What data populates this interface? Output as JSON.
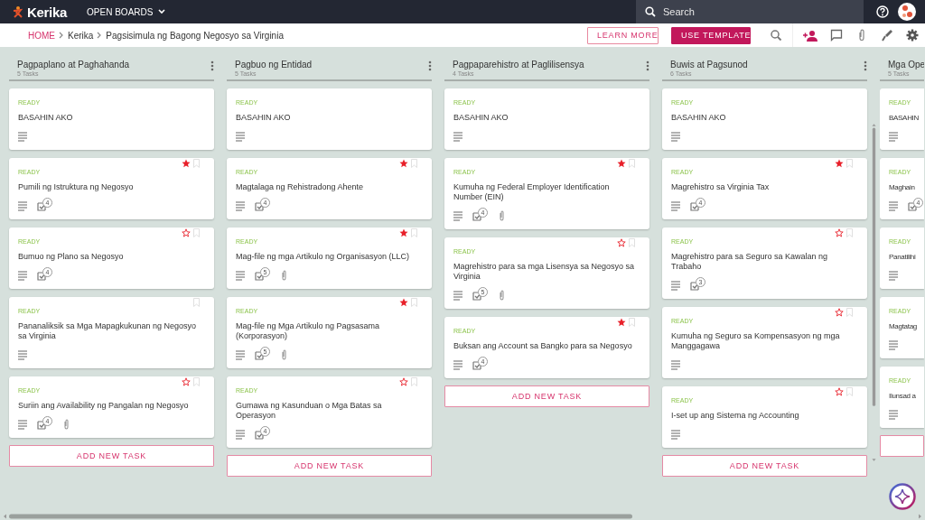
{
  "topbar": {
    "logo": "Kerika",
    "boards_menu": "OPEN BOARDS",
    "search": {
      "placeholder": "Search"
    }
  },
  "breadcrumb": {
    "items": [
      "HOME",
      "Kerika",
      "Pagsisimula ng Bagong Negosyo sa Virginia"
    ],
    "buttons": [
      {
        "kind": "outline",
        "label": "LEARN MORE"
      },
      {
        "kind": "filled",
        "label": "USE TEMPLATE"
      }
    ]
  },
  "columns": [
    {
      "title": "Pagpaplano at Paghahanda",
      "count": "5 Tasks",
      "scrollbar": false,
      "cut": false,
      "add_button": "ADD NEW TASK",
      "cards": [
        {
          "status": "READY",
          "title": "BASAHIN AKO",
          "bookmark": false,
          "attachment": false
        },
        {
          "status": "READY",
          "title": "Pumili ng Istruktura ng Negosyo",
          "starred": true,
          "bookmark": true,
          "checklist": "4",
          "attachment": false
        },
        {
          "status": "READY",
          "title": "Bumuo ng Plano sa Negosyo",
          "starred": false,
          "bookmark": true,
          "checklist": "4",
          "attachment": false
        },
        {
          "status": "READY",
          "title": "Pananaliksik sa Mga Mapagkukunan ng Negosyo sa Virginia",
          "bookmark": true,
          "attachment": false
        },
        {
          "status": "READY",
          "title": "Suriin ang Availability ng Pangalan ng Negosyo",
          "starred": false,
          "bookmark": true,
          "checklist": "4",
          "attachment": true
        }
      ]
    },
    {
      "title": "Pagbuo ng Entidad",
      "count": "5 Tasks",
      "scrollbar": false,
      "cut": false,
      "add_button": "ADD NEW TASK",
      "cards": [
        {
          "status": "READY",
          "title": "BASAHIN AKO",
          "bookmark": false,
          "attachment": false
        },
        {
          "status": "READY",
          "title": "Magtalaga ng Rehistradong Ahente",
          "starred": true,
          "bookmark": true,
          "checklist": "4",
          "attachment": false
        },
        {
          "status": "READY",
          "title": "Mag-file ng mga Artikulo ng Organisasyon (LLC)",
          "starred": true,
          "bookmark": true,
          "checklist": "5",
          "attachment": true
        },
        {
          "status": "READY",
          "title": "Mag-file ng Mga Artikulo ng Pagsasama (Korporasyon)",
          "starred": true,
          "bookmark": true,
          "checklist": "5",
          "attachment": true
        },
        {
          "status": "READY",
          "title": "Gumawa ng Kasunduan o Mga Batas sa Operasyon",
          "starred": false,
          "bookmark": true,
          "checklist": "4",
          "attachment": false
        }
      ]
    },
    {
      "title": "Pagpaparehistro at Paglilisensya",
      "count": "4 Tasks",
      "scrollbar": false,
      "cut": false,
      "add_button": "ADD NEW TASK",
      "cards": [
        {
          "status": "READY",
          "title": "BASAHIN AKO",
          "bookmark": false,
          "attachment": false
        },
        {
          "status": "READY",
          "title": "Kumuha ng Federal Employer Identification Number (EIN)",
          "starred": true,
          "bookmark": true,
          "checklist": "4",
          "attachment": true
        },
        {
          "status": "READY",
          "title": "Magrehistro para sa mga Lisensya sa Negosyo sa Virginia",
          "starred": false,
          "bookmark": true,
          "checklist": "5",
          "attachment": true
        },
        {
          "status": "READY",
          "title": "Buksan ang Account sa Bangko para sa Negosyo",
          "starred": true,
          "bookmark": true,
          "checklist": "4",
          "attachment": false
        }
      ]
    },
    {
      "title": "Buwis at Pagsunod",
      "count": "6 Tasks",
      "scrollbar": true,
      "cut": false,
      "add_button": "ADD NEW TASK",
      "cards": [
        {
          "status": "READY",
          "title": "BASAHIN AKO",
          "bookmark": false,
          "attachment": false
        },
        {
          "status": "READY",
          "title": "Magrehistro sa Virginia Tax",
          "starred": true,
          "bookmark": true,
          "checklist": "4",
          "attachment": false
        },
        {
          "status": "READY",
          "title": "Magrehistro para sa Seguro sa Kawalan ng Trabaho",
          "starred": false,
          "bookmark": true,
          "checklist": "3",
          "attachment": false
        },
        {
          "status": "READY",
          "title": "Kumuha ng Seguro sa Kompensasyon ng mga Manggagawa",
          "starred": false,
          "bookmark": true,
          "attachment": false
        },
        {
          "status": "READY",
          "title": "I-set up ang Sistema ng Accounting",
          "starred": false,
          "bookmark": true,
          "attachment": false
        }
      ]
    },
    {
      "title": "Mga Ope",
      "count": "5 Tasks",
      "scrollbar": false,
      "cut": true,
      "cards": [
        {
          "status": "READY",
          "title": "BASAHIN",
          "attachment": false
        },
        {
          "status": "READY",
          "title": "Maghain",
          "checklist": "4",
          "attachment": false
        },
        {
          "status": "READY",
          "title": "Panatilihi",
          "attachment": false
        },
        {
          "status": "READY",
          "title": "Magtatag",
          "attachment": false
        },
        {
          "status": "READY",
          "title": "Ilunsad a",
          "attachment": false
        }
      ]
    }
  ]
}
